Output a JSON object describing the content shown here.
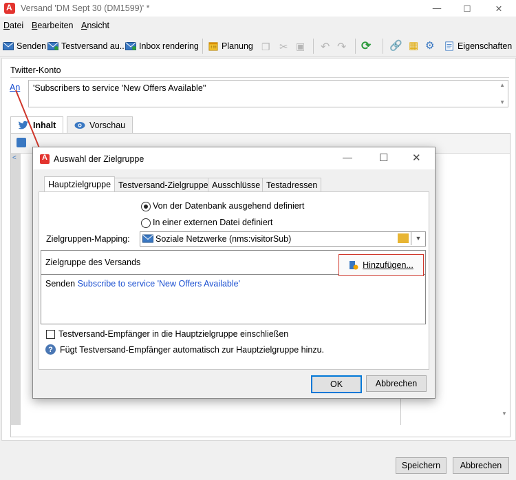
{
  "window": {
    "title": "Versand 'DM Sept 30 (DM1599)' *",
    "logo_letter": "A",
    "controls": {
      "minimize": "—",
      "maximize": "☐",
      "close": "✕"
    }
  },
  "menu": [
    {
      "underline": "D",
      "rest": "atei"
    },
    {
      "underline": "B",
      "rest": "earbeiten"
    },
    {
      "underline": "A",
      "rest": "nsicht"
    }
  ],
  "toolbar": {
    "send": "Senden",
    "proof": "Testversand au...",
    "inbox": "Inbox rendering",
    "schedule": "Planung",
    "properties": "Eigenschaften"
  },
  "account": {
    "section_label": "Twitter-Konto",
    "to_link": "An",
    "to_value": "'Subscribers to service 'New Offers Available''"
  },
  "tabs": {
    "content": "Inhalt",
    "preview": "Vorschau"
  },
  "editor": {
    "gutter_text": "<"
  },
  "footer": {
    "save": "Speichern",
    "cancel": "Abbrechen"
  },
  "dialog": {
    "title": "Auswahl der Zielgruppe",
    "logo_letter": "A",
    "tabs": [
      "Hauptzielgruppe",
      "Testversand-Zielgruppe",
      "Ausschlüsse",
      "Testadressen"
    ],
    "radio_db": "Von der Datenbank ausgehend definiert",
    "radio_file": "In einer externen Datei definiert",
    "mapping_label": "Zielgruppen-Mapping:",
    "mapping_value": "Soziale Netzwerke (nms:visitorSub)",
    "target_heading": "Zielgruppe des Versands",
    "add_button": "Hinzufügen...",
    "target_prefix": "Senden",
    "target_link": "Subscribe to service 'New Offers Available'",
    "checkbox_label": "Testversand-Empfänger in die Hauptzielgruppe einschließen",
    "help_text": "Fügt Testversand-Empfänger automatisch zur Hauptzielgruppe hinzu.",
    "ok": "OK",
    "cancel": "Abbrechen"
  },
  "colors": {
    "accent": "#e3342f",
    "link": "#1a4fd1",
    "highlight": "#d0362a"
  }
}
